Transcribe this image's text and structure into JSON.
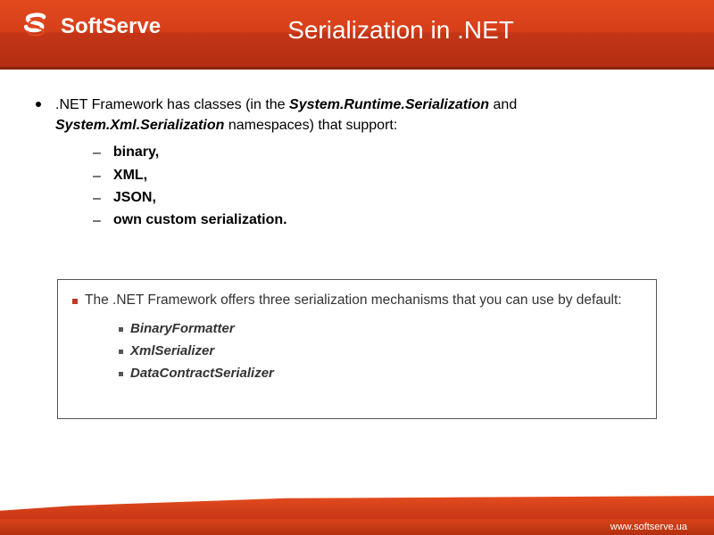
{
  "header": {
    "brand": "SoftServe",
    "title": "Serialization in .NET"
  },
  "lead": {
    "prefix": ".NET Framework has classes (in the ",
    "ns1": "System.Runtime.Serialization",
    "mid": " and ",
    "ns2": "System.Xml.Serialization",
    "suffix": " namespaces) that support:"
  },
  "formats": [
    "binary,",
    "XML,",
    "JSON,",
    "own custom serialization."
  ],
  "box": {
    "lead": "The .NET Framework offers three serialization mechanisms that you can use by default:",
    "items": [
      "BinaryFormatter",
      "XmlSerializer",
      "DataContractSerializer"
    ]
  },
  "footer": {
    "url": "www.softserve.ua"
  }
}
